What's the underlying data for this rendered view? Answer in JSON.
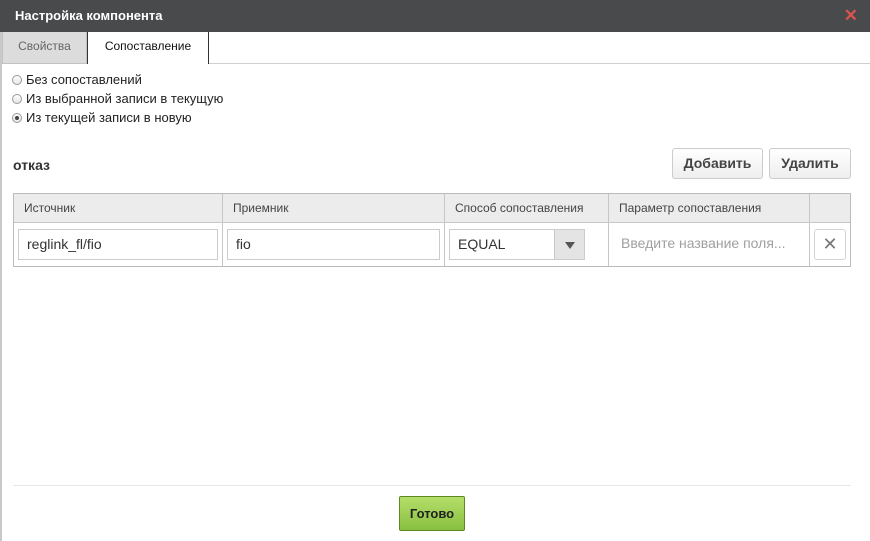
{
  "dialog": {
    "title": "Настройка компонента",
    "close_icon": "close-icon"
  },
  "tabs": [
    {
      "label": "Свойства",
      "active": false
    },
    {
      "label": "Сопоставление",
      "active": true
    }
  ],
  "mapping_mode": {
    "options": [
      {
        "label": "Без сопоставлений",
        "checked": false
      },
      {
        "label": "Из выбранной записи в текущую",
        "checked": false
      },
      {
        "label": "Из текущей записи в новую",
        "checked": true
      }
    ]
  },
  "section": {
    "label": "отказ",
    "add_label": "Добавить",
    "delete_label": "Удалить"
  },
  "table": {
    "columns": [
      "Источник",
      "Приемник",
      "Способ сопоставления",
      "Параметр сопоставления"
    ],
    "rows": [
      {
        "source": "reglink_fl/fio",
        "target": "fio",
        "method": "EQUAL",
        "param_placeholder": "Введите название поля..."
      }
    ]
  },
  "footer": {
    "done_label": "Готово"
  },
  "colors": {
    "titlebar": "#484a4c",
    "close": "#d9534f",
    "done_button": "#9fcf55"
  }
}
